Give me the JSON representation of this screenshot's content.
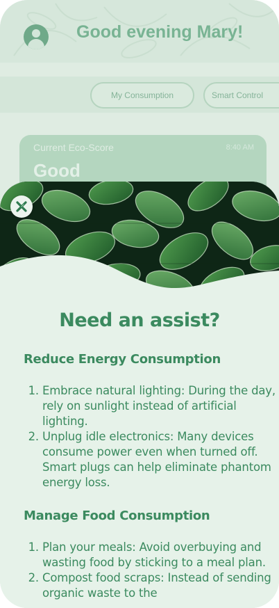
{
  "background": {
    "greeting": "Good evening Mary!",
    "tabs": [
      "My Consumption",
      "Smart Control"
    ],
    "card": {
      "label": "Current Eco-Score",
      "time": "8:40 AM",
      "score": "Good"
    }
  },
  "sheet": {
    "close_icon": "close-icon",
    "title": "Need an assist?",
    "sections": [
      {
        "heading": "Reduce Energy Consumption",
        "items": [
          "Embrace natural lighting: During the day, rely on sunlight instead of artificial lighting.",
          "Unplug idle electronics: Many devices consume power even when turned off. Smart plugs can help eliminate phantom energy loss."
        ]
      },
      {
        "heading": "Manage Food Consumption",
        "items": [
          "Plan your meals: Avoid overbuying and wasting food by sticking to a meal plan.",
          "Compost food scraps: Instead of sending organic waste to the"
        ]
      }
    ]
  },
  "colors": {
    "accent": "#3b8a5f",
    "sheet_bg": "#e6f2e9",
    "leaf_dark": "#0f2a17"
  }
}
